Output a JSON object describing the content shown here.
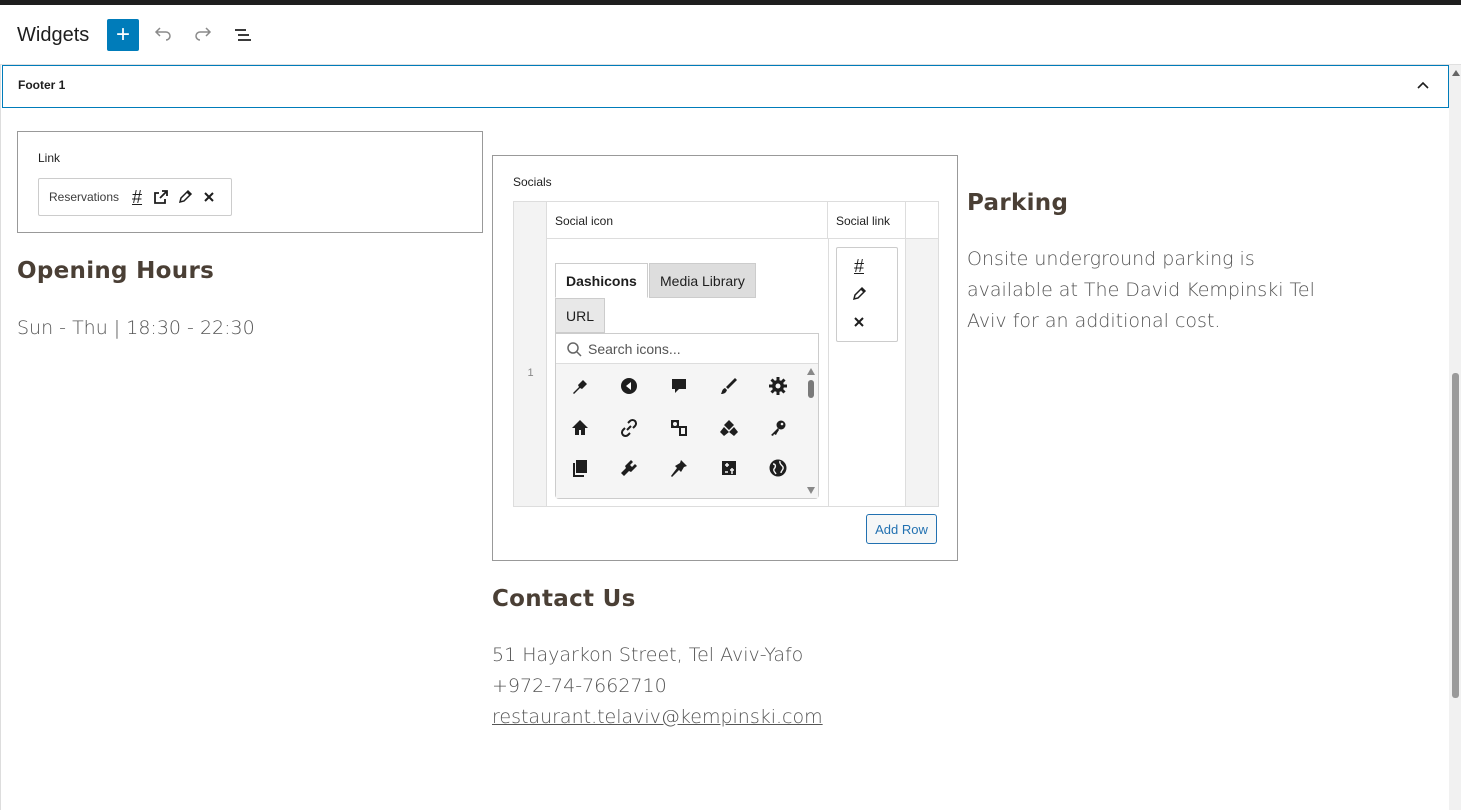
{
  "header": {
    "title": "Widgets",
    "add_label": "+"
  },
  "footer_panel": {
    "label": "Footer 1"
  },
  "link_block": {
    "label": "Link",
    "link_text": "Reservations",
    "link_url": "#"
  },
  "opening_hours": {
    "heading": "Opening Hours",
    "text": "Sun - Thu | 18:30 - 22:30"
  },
  "socials": {
    "label": "Socials",
    "columns": [
      "Social icon",
      "Social link"
    ],
    "row_number": "1",
    "tabs": [
      "Dashicons",
      "Media Library",
      "URL"
    ],
    "search_placeholder": "Search icons...",
    "link_url": "#",
    "add_row_label": "Add Row",
    "icons": [
      "admin-appearance-icon",
      "back-icon",
      "comment-icon",
      "brush-icon",
      "gear-icon",
      "home-icon",
      "link-icon",
      "media-icon",
      "network-icon",
      "key-icon",
      "copy-icon",
      "plugin-icon",
      "pin-icon",
      "tools-icon",
      "globe-icon"
    ]
  },
  "parking": {
    "heading": "Parking",
    "lines": [
      "Onsite underground parking is",
      "available at The David Kempinski Tel",
      "Aviv for an additional cost."
    ]
  },
  "contact": {
    "heading": "Contact Us",
    "address": "51 Hayarkon Street, Tel Aviv-Yafo",
    "phone": "+972-74-7662710",
    "email": "restaurant.telaviv@kempinski.com"
  },
  "colors": {
    "accent": "#007cba",
    "heading": "#4a3f35",
    "body_text": "#555555"
  }
}
